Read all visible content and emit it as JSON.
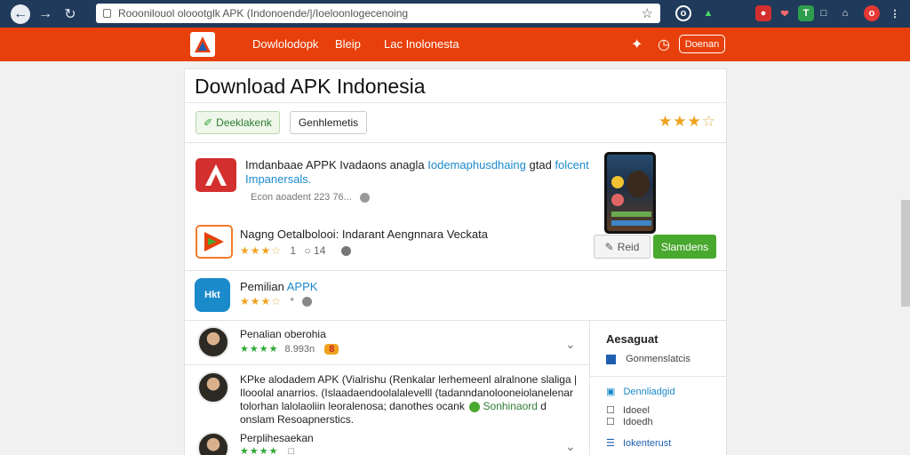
{
  "browser": {
    "url": "Rooonilouol oloootglk APK (Indonoende/|/Ioeloonlogecenoing",
    "back_icon": "arrow-left",
    "forward_icon": "arrow-right",
    "reload_icon": "reload"
  },
  "header": {
    "nav": [
      "Dowlolodopk",
      "Bleip",
      "Lac Inolonesta"
    ],
    "signin_label": "Doenan"
  },
  "page": {
    "title": "Download APK Indonesia",
    "download_button": "Deeklakenk",
    "secondary_button": "Genhlemetis"
  },
  "featured": {
    "title": "Imdanbaae APPK Ivadaons anagla",
    "title_blue": "Iodemaphusdhaing",
    "title_tail": "gtad",
    "title_blue2": "folcent",
    "subtitle": "Impanersals.",
    "meta": "Econ aoadent 223 76...",
    "second_title": "Nagng Oetalbolooi: Indarant Aengnnara Veckata",
    "second_meta_a": "1",
    "second_meta_b": "14",
    "open_button": "Reid",
    "install_button": "Slamdens"
  },
  "app3": {
    "name": "Pemilian",
    "name_blue": "APPK",
    "meta": "*"
  },
  "reviews": [
    {
      "name": "Penalian oberohia",
      "meta": "8.993n",
      "badge": "8"
    },
    {
      "name": "KPke alodadem APK (Vialrishu (Renkalar lerhemeenl alralnone slaliga |",
      "line2": "Ilooolal anarrios. (Islaadaendoolalalevelll (tadanndanolooneiolanelenar",
      "line3": "tolorhan lalolaoliin leoralenosa;  danothes ocank",
      "line3_blue": "Sonhinaord",
      "line3_tail": "d",
      "line4": "onslam Resoapnerstics."
    },
    {
      "name": "Perplihesaekan",
      "meta": ""
    }
  ],
  "sidebar": {
    "title": "Aesaguat",
    "item1": "Gonmenslatcis",
    "item2": "Dennliadgid",
    "item3": "Idoeel",
    "item4": "Idoedh",
    "item5": "Iokenterust"
  },
  "colors": {
    "brand": "#e8400c",
    "chrome": "#1f3a5b",
    "accent_green": "#49a82e",
    "link_blue": "#1a8acb",
    "star": "#f0a21e"
  }
}
